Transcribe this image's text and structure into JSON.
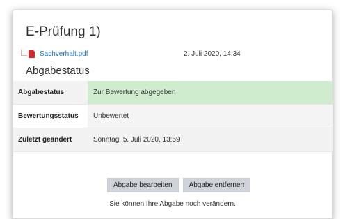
{
  "page": {
    "title": "E-Prüfung 1)"
  },
  "file": {
    "icon": "pdf-icon",
    "name": "Sachverhalt.pdf",
    "date": "2. Juli 2020, 14:34"
  },
  "status_section": {
    "heading": "Abgabestatus",
    "rows": [
      {
        "label": "Abgabestatus",
        "value": "Zur Bewertung abgegeben",
        "highlight": "#cfeccf"
      },
      {
        "label": "Bewertungsstatus",
        "value": "Unbewertet"
      },
      {
        "label": "Zuletzt geändert",
        "value": "Sonntag, 5. Juli 2020, 13:59"
      }
    ]
  },
  "actions": {
    "edit_label": "Abgabe bearbeiten",
    "remove_label": "Abgabe entfernen",
    "hint": "Sie können Ihre Abgabe noch verändern."
  },
  "colors": {
    "link": "#1a73c6",
    "pdf_icon": "#d22a2a",
    "button_bg": "#ced4da"
  }
}
